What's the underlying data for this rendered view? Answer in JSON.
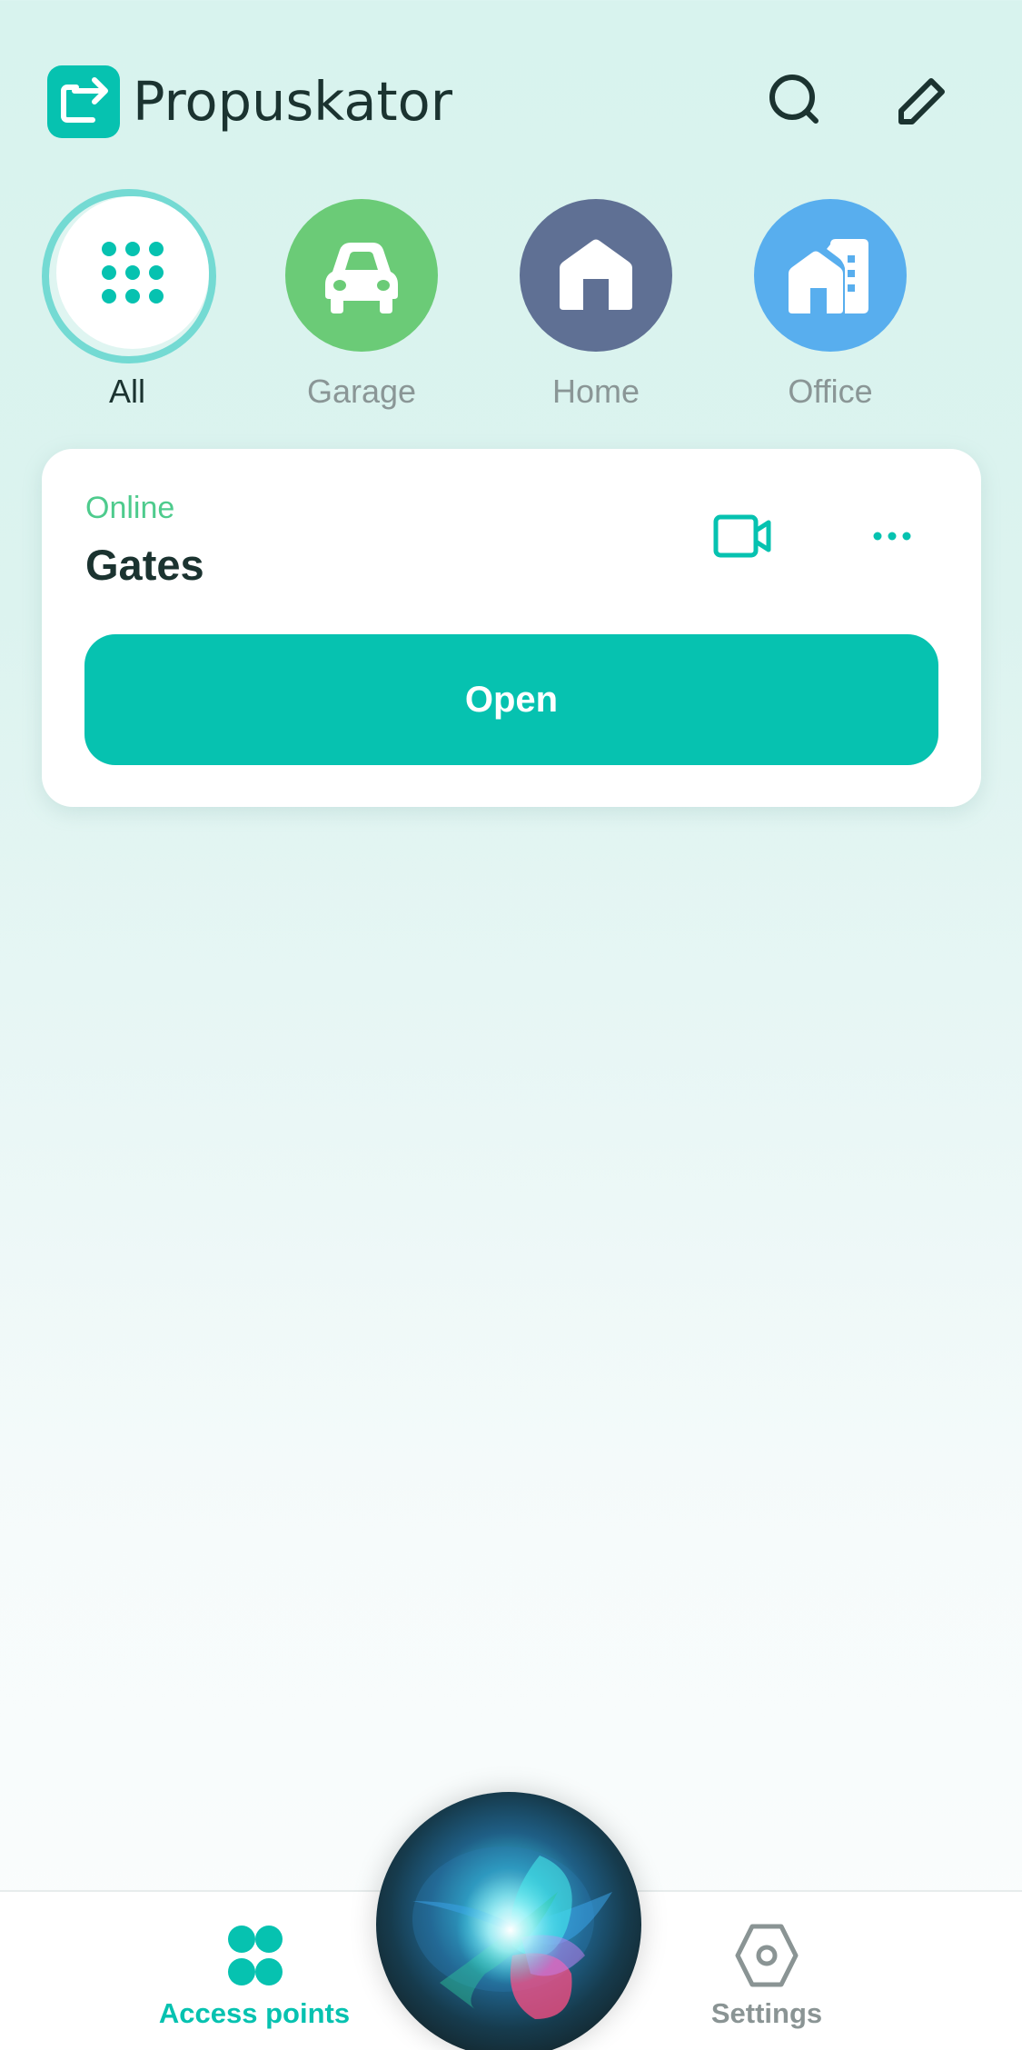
{
  "header": {
    "app_title": "Propuskator",
    "logo_icon": "exit-arrow-icon",
    "search_icon": "search-icon",
    "edit_icon": "pencil-icon"
  },
  "categories": [
    {
      "label": "All",
      "icon": "grid-dots-icon",
      "color": "#ffffff",
      "active": true
    },
    {
      "label": "Garage",
      "icon": "car-icon",
      "color": "#6bcb77",
      "active": false
    },
    {
      "label": "Home",
      "icon": "house-icon",
      "color": "#5f7094",
      "active": false
    },
    {
      "label": "Office",
      "icon": "office-building-icon",
      "color": "#58aeee",
      "active": false
    }
  ],
  "access_points": [
    {
      "status": "Online",
      "name": "Gates",
      "video_icon": "video-camera-icon",
      "more_icon": "more-dots-icon",
      "action_label": "Open"
    }
  ],
  "tabbar": {
    "tabs": [
      {
        "label": "Access points",
        "icon": "four-dots-icon",
        "active": true
      },
      {
        "label": "Settings",
        "icon": "hexagon-gear-icon",
        "active": false
      }
    ],
    "assistant_icon": "siri-orb-icon"
  },
  "colors": {
    "accent": "#06c2b0",
    "online": "#4ecb8d",
    "text_dark": "#1b3330",
    "text_muted": "#8a9696"
  }
}
